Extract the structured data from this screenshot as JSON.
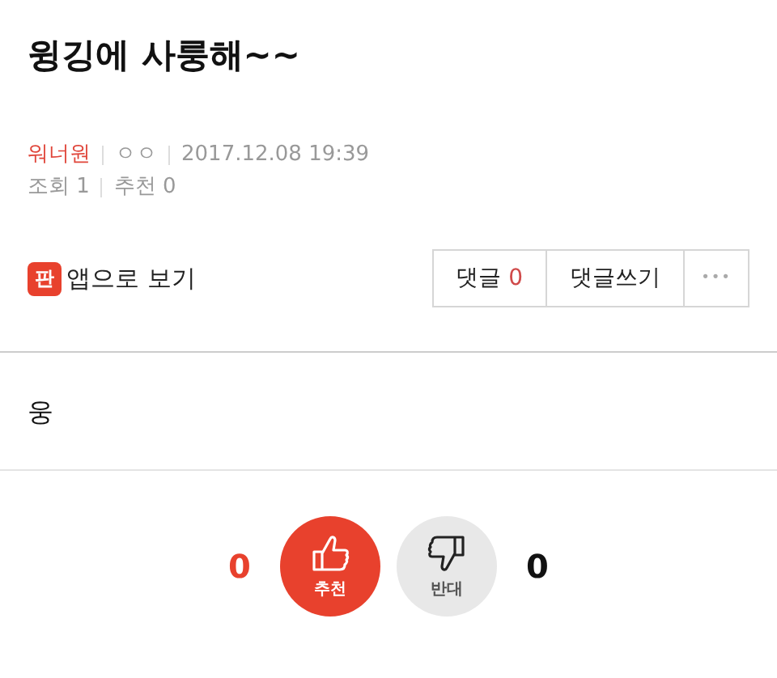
{
  "title": "윙깅에 사룽해~~",
  "meta": {
    "author": "워너원",
    "nickname": "ㅇㅇ",
    "date": "2017.12.08 19:39",
    "views": "조회 1",
    "recommends": "추천 0"
  },
  "app_link": {
    "logo": "판",
    "label": "앱으로 보기"
  },
  "actions": {
    "comments_label": "댓글",
    "comments_count": "0",
    "write_label": "댓글쓰기",
    "more": "•••"
  },
  "body": "웅",
  "votes": {
    "up_count": "0",
    "up_label": "추천",
    "down_label": "반대",
    "down_count": "0"
  }
}
